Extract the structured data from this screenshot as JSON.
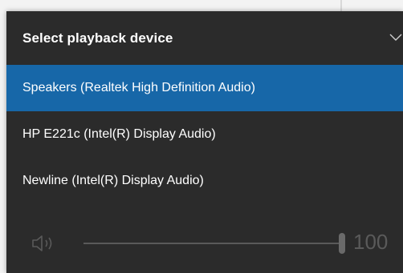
{
  "flyout": {
    "title": "Select playback device",
    "devices": [
      {
        "label": "Speakers (Realtek High Definition Audio)",
        "selected": true
      },
      {
        "label": "HP E221c (Intel(R) Display Audio)",
        "selected": false
      },
      {
        "label": "Newline (Intel(R) Display Audio)",
        "selected": false
      }
    ],
    "volume": {
      "value_text": "100",
      "level_percent": 100
    }
  },
  "icons": {
    "expand": "chevron-down-icon",
    "volume": "speaker-icon"
  },
  "colors": {
    "flyout_bg": "#2b2b2b",
    "selected_bg": "#1767a8",
    "disabled": "#5a5a5a"
  }
}
